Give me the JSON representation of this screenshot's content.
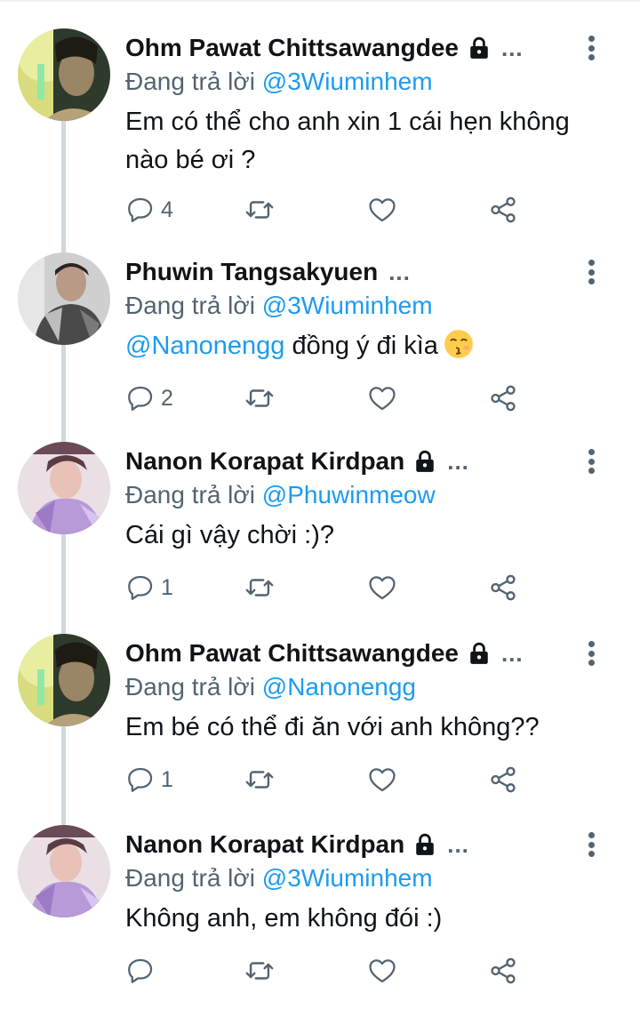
{
  "tweets": [
    {
      "name": "Ohm Pawat Chittsawangdee",
      "locked": true,
      "avatar": "ohm-avatar",
      "replying_prefix": "Đang trả lời",
      "replying_to": "@3Wiuminhem",
      "text": "Em có thể cho anh xin 1 cái hẹn không nào bé ơi ?",
      "mention": "",
      "emoji": "",
      "reply_count": "4"
    },
    {
      "name": "Phuwin Tangsakyuen",
      "locked": false,
      "avatar": "phuwin-avatar",
      "replying_prefix": "Đang trả lời",
      "replying_to": "@3Wiuminhem",
      "text": " đồng ý đi kìa",
      "mention": "@Nanonengg",
      "emoji": "kissing-face-emoji",
      "reply_count": "2"
    },
    {
      "name": "Nanon Korapat Kirdpan",
      "locked": true,
      "avatar": "nanon-avatar",
      "replying_prefix": "Đang trả lời",
      "replying_to": "@Phuwinmeow",
      "text": "Cái gì vậy chời :)?",
      "mention": "",
      "emoji": "",
      "reply_count": "1"
    },
    {
      "name": "Ohm Pawat Chittsawangdee",
      "locked": true,
      "avatar": "ohm-avatar",
      "replying_prefix": "Đang trả lời",
      "replying_to": "@Nanonengg",
      "text": "Em bé có thể đi ăn với anh không??",
      "mention": "",
      "emoji": "",
      "reply_count": "1"
    },
    {
      "name": "Nanon Korapat Kirdpan",
      "locked": true,
      "avatar": "nanon-avatar",
      "replying_prefix": "Đang trả lời",
      "replying_to": "@3Wiuminhem",
      "text": "Không anh, em không đói :)",
      "mention": "",
      "emoji": "",
      "reply_count": ""
    }
  ],
  "ellipsis": "...",
  "icons": {
    "reply": "reply-icon",
    "retweet": "retweet-icon",
    "like": "heart-icon",
    "share": "share-icon",
    "more": "more-vertical-icon",
    "lock": "lock-icon"
  },
  "colors": {
    "link": "#1d9bf0",
    "secondary_text": "#536471",
    "primary_text": "#0f1419",
    "thread_line": "#cfd9de"
  }
}
